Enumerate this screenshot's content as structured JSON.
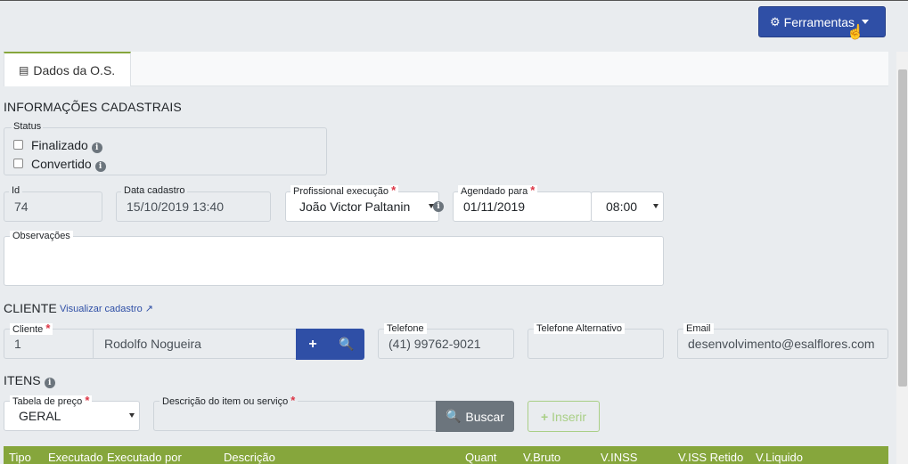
{
  "toolbar": {
    "tools_label": "Ferramentas"
  },
  "tabs": [
    {
      "label": "Dados da O.S."
    }
  ],
  "sections": {
    "info": "INFORMAÇÕES CADASTRAIS",
    "cliente": "CLIENTE",
    "itens": "ITENS"
  },
  "status": {
    "legend": "Status",
    "finalizado": "Finalizado",
    "convertido": "Convertido"
  },
  "fields": {
    "id": {
      "label": "Id",
      "value": "74"
    },
    "data_cadastro": {
      "label": "Data cadastro",
      "value": "15/10/2019 13:40"
    },
    "profissional": {
      "label": "Profissional execução",
      "value": "João Victor Paltanin"
    },
    "agendado": {
      "label": "Agendado para",
      "date": "01/11/2019",
      "time": "08:00"
    },
    "observacoes": {
      "label": "Observações",
      "value": ""
    },
    "cliente": {
      "label": "Cliente",
      "code": "1",
      "name": "Rodolfo Nogueira"
    },
    "telefone": {
      "label": "Telefone",
      "value": "(41) 99762-9021"
    },
    "telefone_alt": {
      "label": "Telefone Alternativo",
      "value": ""
    },
    "email": {
      "label": "Email",
      "value": "desenvolvimento@esalflores.com"
    },
    "tabela_preco": {
      "label": "Tabela de preço",
      "value": "GERAL"
    },
    "descricao": {
      "label": "Descrição do item ou serviço",
      "value": ""
    }
  },
  "links": {
    "visualizar": "Visualizar cadastro"
  },
  "buttons": {
    "buscar": "Buscar",
    "inserir": "Inserir"
  },
  "table": {
    "headers": [
      "Tipo",
      "Executado",
      "Executado por",
      "Descrição",
      "Quant",
      "V.Bruto",
      "V.INSS",
      "V.ISS Retido",
      "V.Liquido"
    ]
  },
  "colors": {
    "primary": "#2f4fa6",
    "accent_green": "#86a63c",
    "required": "#dc3545"
  }
}
